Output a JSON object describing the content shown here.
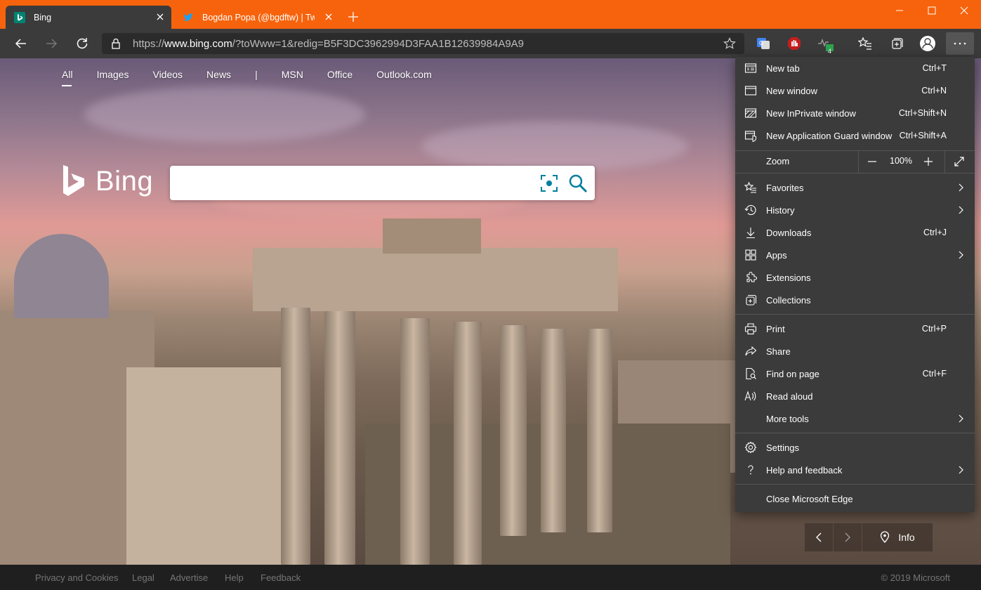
{
  "tabs": [
    {
      "title": "Bing",
      "favicon": "bing-icon",
      "active": true
    },
    {
      "title": "Bogdan Popa (@bgdftw) | Twitter",
      "favicon": "twitter-icon",
      "active": false
    }
  ],
  "window_controls": {
    "minimize": "minimize-icon",
    "maximize": "maximize-icon",
    "close": "close-icon"
  },
  "address_bar": {
    "url_scheme": "https://",
    "url_host": "www.bing.com",
    "url_rest": "/?toWww=1&redig=B5F3DC3962994D3FAA1B12639984A9A9"
  },
  "extensions": {
    "badge_count": "4"
  },
  "colors": {
    "titlebar": "#f7630c",
    "toolbar": "#3b3b3b",
    "menu": "#3b3b3b",
    "accent_blue": "#0078d4"
  },
  "bing": {
    "scopes": [
      "All",
      "Images",
      "Videos",
      "News",
      "|",
      "MSN",
      "Office",
      "Outlook.com"
    ],
    "logo_text": "Bing"
  },
  "image_nav": {
    "info_label": "Info"
  },
  "footer": {
    "links": [
      "Privacy and Cookies",
      "Legal",
      "Advertise",
      "Help",
      "Feedback"
    ],
    "copyright": "© 2019 Microsoft"
  },
  "menu": {
    "items": [
      {
        "label": "New tab",
        "shortcut": "Ctrl+T",
        "icon": "new-tab-icon"
      },
      {
        "label": "New window",
        "shortcut": "Ctrl+N",
        "icon": "new-window-icon"
      },
      {
        "label": "New InPrivate window",
        "shortcut": "Ctrl+Shift+N",
        "icon": "inprivate-icon"
      },
      {
        "label": "New Application Guard window",
        "shortcut": "Ctrl+Shift+A",
        "icon": "app-guard-icon"
      },
      {
        "label": "Favorites",
        "shortcut": "",
        "icon": "favorites-icon",
        "submenu": true
      },
      {
        "label": "History",
        "shortcut": "",
        "icon": "history-icon",
        "submenu": true
      },
      {
        "label": "Downloads",
        "shortcut": "Ctrl+J",
        "icon": "download-icon"
      },
      {
        "label": "Apps",
        "shortcut": "",
        "icon": "apps-icon",
        "submenu": true
      },
      {
        "label": "Extensions",
        "shortcut": "",
        "icon": "extensions-icon"
      },
      {
        "label": "Collections",
        "shortcut": "",
        "icon": "collections-icon"
      },
      {
        "label": "Print",
        "shortcut": "Ctrl+P",
        "icon": "print-icon"
      },
      {
        "label": "Share",
        "shortcut": "",
        "icon": "share-icon"
      },
      {
        "label": "Find on page",
        "shortcut": "Ctrl+F",
        "icon": "find-icon"
      },
      {
        "label": "Read aloud",
        "shortcut": "",
        "icon": "read-aloud-icon"
      },
      {
        "label": "More tools",
        "shortcut": "",
        "icon": "",
        "submenu": true
      },
      {
        "label": "Settings",
        "shortcut": "",
        "icon": "gear-icon"
      },
      {
        "label": "Help and feedback",
        "shortcut": "",
        "icon": "help-icon",
        "submenu": true
      },
      {
        "label": "Close Microsoft Edge",
        "shortcut": "",
        "icon": ""
      }
    ],
    "zoom": {
      "label": "Zoom",
      "value": "100%"
    }
  }
}
